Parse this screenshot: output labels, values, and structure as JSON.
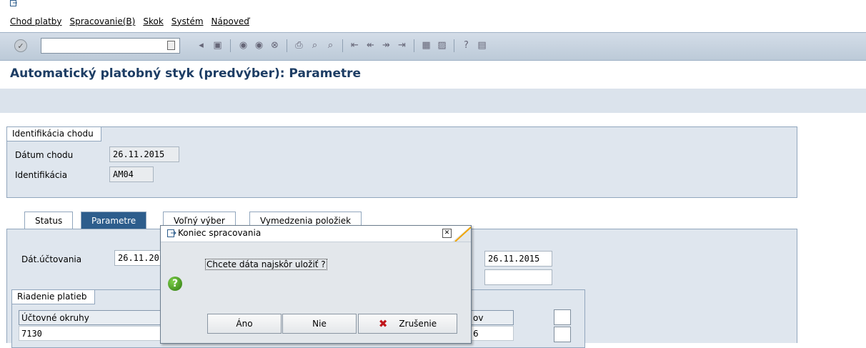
{
  "menu": {
    "items": [
      "Chod platby",
      "Spracovanie(B)",
      "Skok",
      "Systém",
      "Nápoveď"
    ]
  },
  "toolbar": {
    "command_value": ""
  },
  "page": {
    "title": "Automatický platobný styk (predvýber): Parametre"
  },
  "identification": {
    "legend": "Identifikácia chodu",
    "run_date_label": "Dátum chodu",
    "run_date_value": "26.11.2015",
    "id_label": "Identifikácia",
    "id_value": "AM04"
  },
  "tabs": [
    {
      "label": "Status"
    },
    {
      "label": "Parametre"
    },
    {
      "label": "Voľný výber"
    },
    {
      "label": "Vymedzenia položiek"
    }
  ],
  "parameters": {
    "posting_date_label": "Dát.účtovania",
    "posting_date_value": "26.11.2015",
    "right_date_value": "26.11.2015",
    "payment_control_legend": "Riadenie platieb",
    "company_codes_header": "Účtovné okruhy",
    "company_code_value": "7130",
    "partial_header": "ov",
    "partial_value": "6"
  },
  "dialog": {
    "title": "Koniec spracovania",
    "question": "Chcete dáta najskôr uložiť ?",
    "yes_label": "Áno",
    "no_label": "Nie",
    "cancel_label": "Zrušenie"
  },
  "colors": {
    "title_color": "#1d3d64",
    "active_tab": "#2d5d8c",
    "question_icon": "#3a8a1c",
    "cancel_x": "#c0161b"
  }
}
